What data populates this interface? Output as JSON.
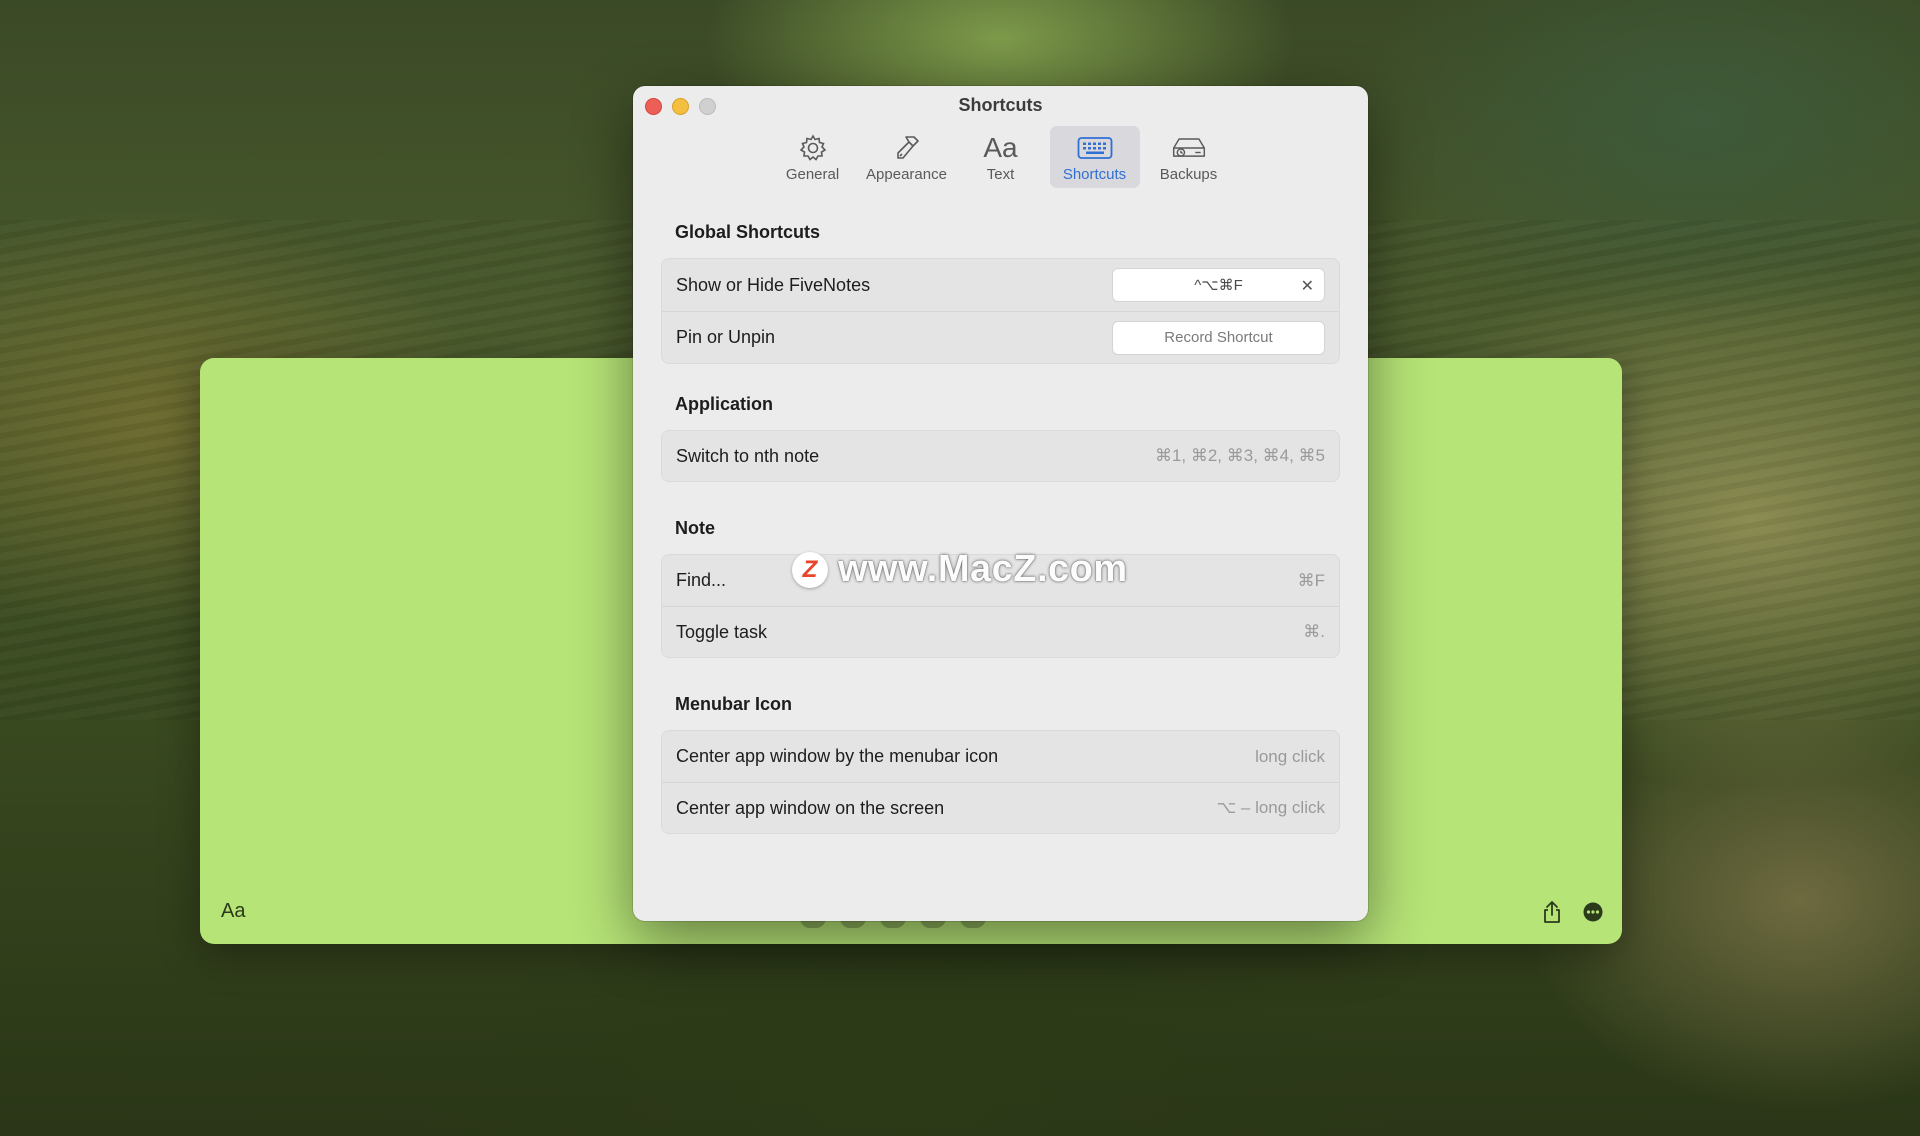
{
  "note": {
    "font_button": "Aa"
  },
  "prefs": {
    "title": "Shortcuts",
    "tabs": [
      {
        "label": "General",
        "icon": "gear-icon"
      },
      {
        "label": "Appearance",
        "icon": "hammer-icon"
      },
      {
        "label": "Text",
        "icon": "text-aa-icon",
        "glyph": "Aa"
      },
      {
        "label": "Shortcuts",
        "icon": "keyboard-icon",
        "active": true
      },
      {
        "label": "Backups",
        "icon": "drive-restore-icon"
      }
    ],
    "sections": {
      "global": {
        "title": "Global Shortcuts",
        "show_hide": {
          "label": "Show or Hide FiveNotes",
          "value": "^⌥⌘F",
          "clear": "✕"
        },
        "pin": {
          "label": "Pin or Unpin",
          "placeholder": "Record Shortcut"
        }
      },
      "application": {
        "title": "Application",
        "switch": {
          "label": "Switch to nth note",
          "hint": "⌘1, ⌘2, ⌘3, ⌘4, ⌘5"
        }
      },
      "note": {
        "title": "Note",
        "find": {
          "label": "Find...",
          "hint": "⌘F"
        },
        "toggle": {
          "label": "Toggle task",
          "hint": "⌘."
        }
      },
      "menubar": {
        "title": "Menubar Icon",
        "center_menubar": {
          "label": "Center app window by the menubar icon",
          "hint": "long click"
        },
        "center_screen": {
          "label": "Center app window on the screen",
          "hint": "⌥ – long click"
        }
      }
    }
  },
  "watermark": {
    "badge": "Z",
    "text": "www.MacZ.com"
  },
  "colors": {
    "note_green": "#b6e477",
    "accent_blue": "#2f6fd6",
    "close_red": "#ec5f57",
    "minimize_yellow": "#f4be3e"
  }
}
